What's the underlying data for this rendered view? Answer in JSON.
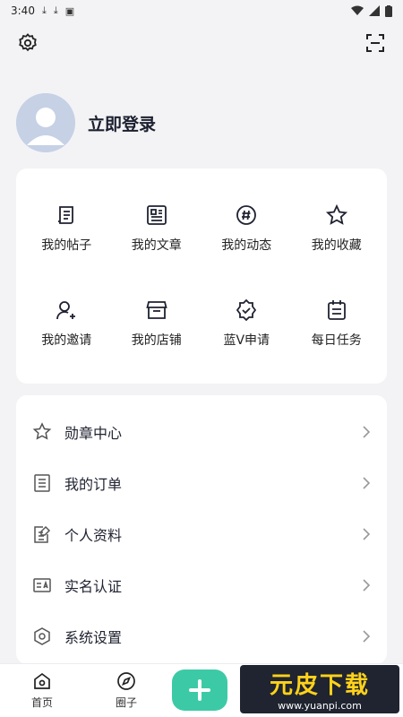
{
  "status_bar": {
    "time": "3:40"
  },
  "profile": {
    "login_text": "立即登录"
  },
  "grid": [
    {
      "label": "我的帖子",
      "icon": "post-icon"
    },
    {
      "label": "我的文章",
      "icon": "article-icon"
    },
    {
      "label": "我的动态",
      "icon": "hashtag-icon"
    },
    {
      "label": "我的收藏",
      "icon": "star-icon"
    },
    {
      "label": "我的邀请",
      "icon": "invite-user-icon"
    },
    {
      "label": "我的店铺",
      "icon": "store-icon"
    },
    {
      "label": "蓝V申请",
      "icon": "badge-check-icon"
    },
    {
      "label": "每日任务",
      "icon": "calendar-task-icon"
    }
  ],
  "list": [
    {
      "label": "勋章中心",
      "icon": "star-outline-icon"
    },
    {
      "label": "我的订单",
      "icon": "order-icon"
    },
    {
      "label": "个人资料",
      "icon": "edit-document-icon"
    },
    {
      "label": "实名认证",
      "icon": "id-card-icon"
    },
    {
      "label": "系统设置",
      "icon": "hex-settings-icon"
    }
  ],
  "tabs": [
    {
      "label": "首页",
      "icon": "home-icon"
    },
    {
      "label": "圈子",
      "icon": "compass-icon"
    }
  ],
  "watermark": {
    "title": "元皮下载",
    "url": "www.yuanpi.com"
  },
  "colors": {
    "accent": "#3ccaa6",
    "background": "#f3f3f5"
  }
}
